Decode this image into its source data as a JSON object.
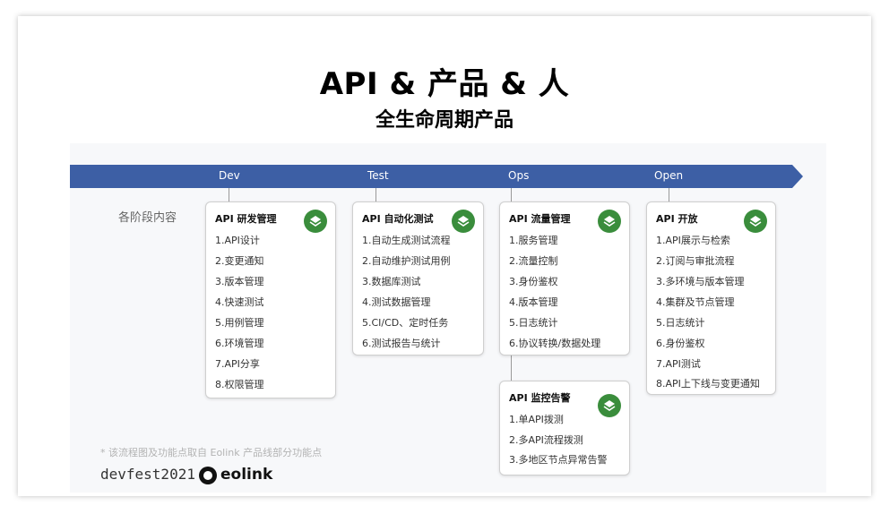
{
  "title": "API & 产品 & 人",
  "subtitle": "全生命周期产品",
  "phases": [
    "Dev",
    "Test",
    "Ops",
    "Open"
  ],
  "stage_label": "各阶段内容",
  "cards": [
    {
      "title": "API 研发管理",
      "items": [
        "1.API设计",
        "2.变更通知",
        "3.版本管理",
        "4.快速测试",
        "5.用例管理",
        "6.环境管理",
        "7.API分享",
        "8.权限管理"
      ]
    },
    {
      "title": "API 自动化测试",
      "items": [
        "1.自动生成测试流程",
        "2.自动维护测试用例",
        "3.数据库测试",
        "4.测试数据管理",
        "5.CI/CD、定时任务",
        "6.测试报告与统计"
      ]
    },
    {
      "title": "API 流量管理",
      "items": [
        "1.服务管理",
        "2.流量控制",
        "3.身份鉴权",
        "4.版本管理",
        "5.日志统计",
        "6.协议转换/数据处理"
      ]
    },
    {
      "title": "API 开放",
      "items": [
        "1.API展示与检索",
        "2.订阅与审批流程",
        "3.多环境与版本管理",
        "4.集群及节点管理",
        "5.日志统计",
        "6.身份鉴权",
        "7.API测试",
        "8.API上下线与变更通知"
      ]
    },
    {
      "title": "API 监控告警",
      "items": [
        "1.单API拨测",
        "2.多API流程拨测",
        "3.多地区节点异常告警"
      ]
    }
  ],
  "footnote": "* 该流程图及功能点取自 Eolink 产品线部分功能点",
  "devfest": "devfest2021",
  "brand": "eolink",
  "colors": {
    "arrow": "#3d5fa5",
    "badge": "#3a8d3c"
  }
}
